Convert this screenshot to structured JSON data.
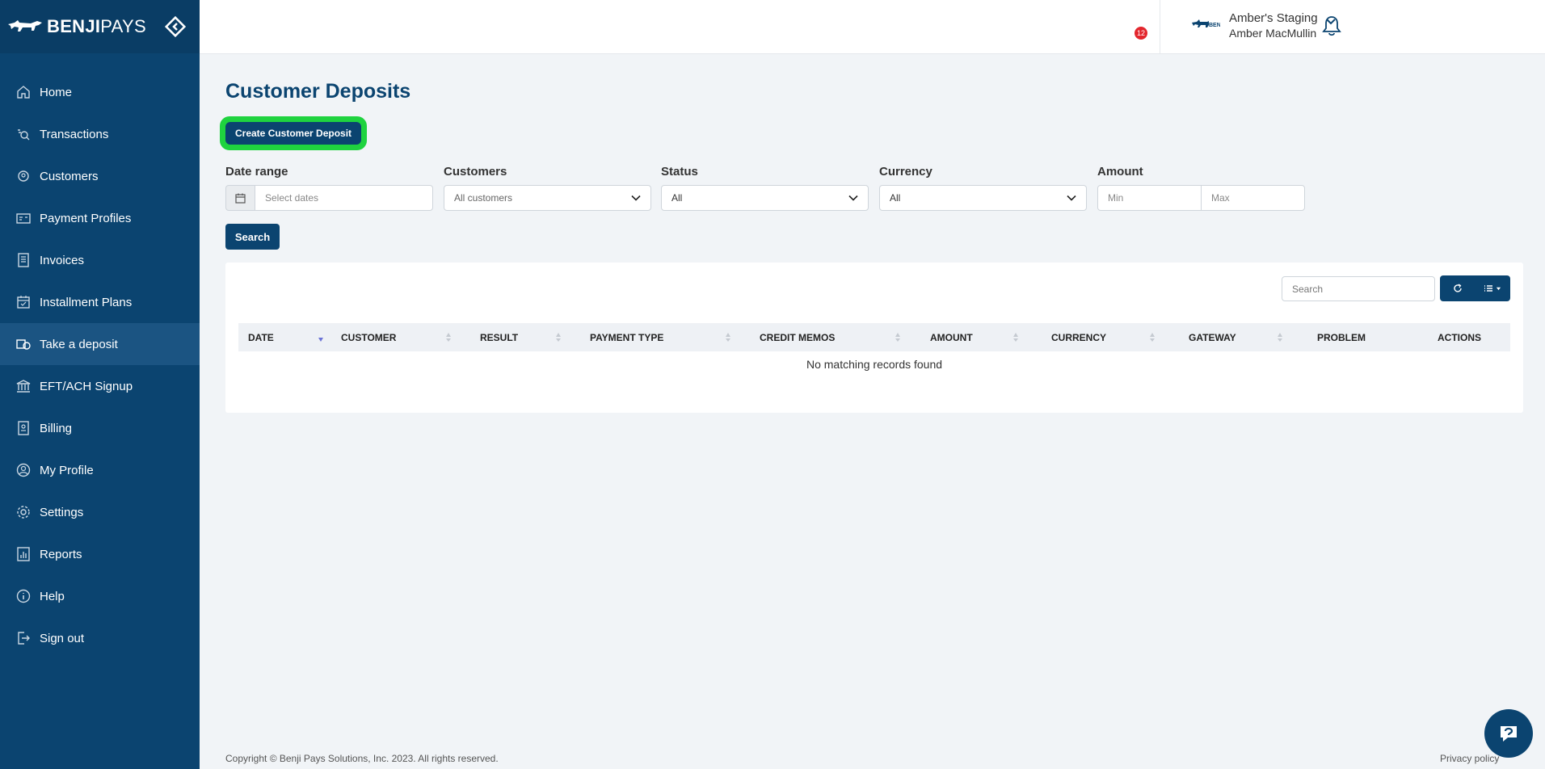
{
  "brand": {
    "name_bold": "BENJI",
    "name_light": "PAYS"
  },
  "colors": {
    "primary": "#0b4470",
    "sidebar_active": "#1b5482",
    "highlight": "#1fd33f",
    "badge": "#e3262d"
  },
  "sidebar": {
    "items": [
      {
        "label": "Home",
        "icon": "home-icon"
      },
      {
        "label": "Transactions",
        "icon": "transactions-icon"
      },
      {
        "label": "Customers",
        "icon": "customers-icon"
      },
      {
        "label": "Payment Profiles",
        "icon": "payment-profiles-icon"
      },
      {
        "label": "Invoices",
        "icon": "invoices-icon"
      },
      {
        "label": "Installment Plans",
        "icon": "installment-plans-icon"
      },
      {
        "label": "Take a deposit",
        "icon": "deposit-icon"
      },
      {
        "label": "EFT/ACH Signup",
        "icon": "bank-icon"
      },
      {
        "label": "Billing",
        "icon": "billing-icon"
      },
      {
        "label": "My Profile",
        "icon": "profile-icon"
      },
      {
        "label": "Settings",
        "icon": "gear-icon"
      },
      {
        "label": "Reports",
        "icon": "reports-icon"
      },
      {
        "label": "Help",
        "icon": "info-icon"
      },
      {
        "label": "Sign out",
        "icon": "sign-out-icon"
      }
    ],
    "active": "Take a deposit"
  },
  "header": {
    "notification_count": "12",
    "company": "Amber's Staging",
    "user": "Amber MacMullin"
  },
  "page": {
    "title": "Customer Deposits",
    "create_button": "Create Customer Deposit"
  },
  "filters": {
    "date_range": {
      "label": "Date range",
      "placeholder": "Select dates"
    },
    "customers": {
      "label": "Customers",
      "value": "All customers"
    },
    "status": {
      "label": "Status",
      "value": "All"
    },
    "currency": {
      "label": "Currency",
      "value": "All"
    },
    "amount": {
      "label": "Amount",
      "min_placeholder": "Min",
      "max_placeholder": "Max"
    },
    "search_button": "Search"
  },
  "table": {
    "search_placeholder": "Search",
    "columns": [
      "DATE",
      "CUSTOMER",
      "RESULT",
      "PAYMENT TYPE",
      "CREDIT MEMOS",
      "AMOUNT",
      "CURRENCY",
      "GATEWAY",
      "PROBLEM",
      "ACTIONS"
    ],
    "sorted_column": "DATE",
    "empty_message": "No matching records found"
  },
  "footer": {
    "copyright": "Copyright © Benji Pays Solutions, Inc. 2023. All rights reserved.",
    "privacy": "Privacy policy"
  }
}
